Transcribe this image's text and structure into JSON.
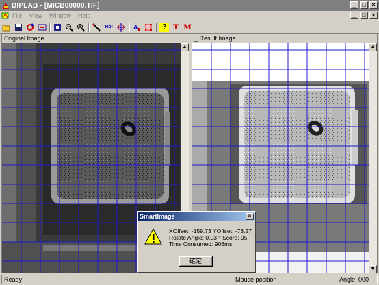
{
  "window": {
    "title": "DIPLAB - [MICB00000.TIF]",
    "min": "_",
    "max": "□",
    "close": "×"
  },
  "menu": [
    "File",
    "View",
    "Window",
    "Help"
  ],
  "toolbar": {
    "icons": [
      "open-icon",
      "save-icon",
      "refresh-icon",
      "compare-icon",
      "fit-icon",
      "zoom-out-icon",
      "zoom-in-icon",
      "measure-icon",
      "roi-icon",
      "target-icon",
      "text-color-icon",
      "grid-icon",
      "help-icon",
      "text-tool-icon",
      "mark-icon"
    ],
    "roi_label": "Roi",
    "help_label": "?",
    "t_label": "T",
    "m_label": "M"
  },
  "panes": {
    "original_title": "Original  Image",
    "result_title": "_ Result Image"
  },
  "dialog": {
    "title": "SmartImage",
    "close": "×",
    "line1": "XOffset: -159.73   YOffset: -73.27",
    "line2": "Rotate Angle:  0.03 °   Score: 95",
    "line3": "Time Consumed: 906ms",
    "ok": "確定"
  },
  "status": {
    "ready": "Ready",
    "mouse": "Mouse position",
    "angle": "Angle: 000"
  }
}
